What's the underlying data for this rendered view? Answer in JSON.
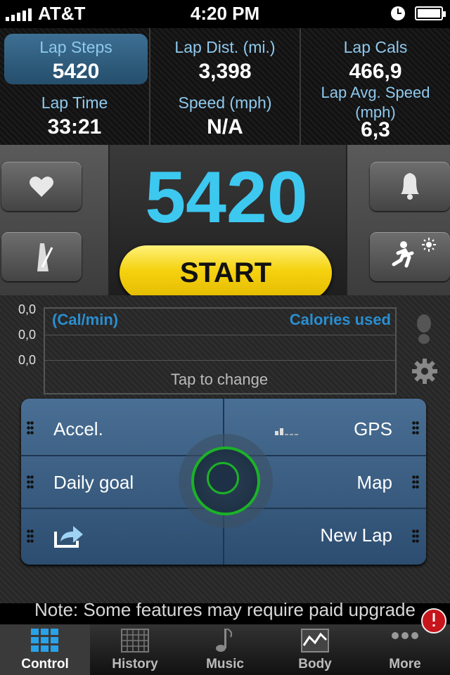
{
  "status_bar": {
    "carrier": "AT&T",
    "time": "4:20 PM"
  },
  "stats": [
    {
      "label": "Lap Steps",
      "value": "5420"
    },
    {
      "label": "Lap Dist. (mi.)",
      "value": "3,398"
    },
    {
      "label": "Lap Cals",
      "value": "466,9"
    },
    {
      "label": "Lap Time",
      "value": "33:21"
    },
    {
      "label": "Speed (mph)",
      "value": "N/A"
    },
    {
      "label": "Lap Avg. Speed (mph)",
      "value": "6,3"
    }
  ],
  "counter": {
    "value": "5420"
  },
  "start_label": "START",
  "graph": {
    "y_labels": [
      "0,0",
      "0,0",
      "0,0"
    ],
    "left_label": "(Cal/min)",
    "right_label": "Calories used",
    "tap_label": "Tap to change"
  },
  "controls": {
    "accel": "Accel.",
    "gps": "GPS",
    "daily_goal": "Daily goal",
    "map": "Map",
    "new_lap": "New Lap"
  },
  "note": "Note: Some features may require paid upgrade",
  "tabs": [
    "Control",
    "History",
    "Music",
    "Body",
    "More"
  ],
  "colors": {
    "accent": "#3dc8f0",
    "label_blue": "#8fc9ee",
    "start_yellow": "#f5d210",
    "ring_green": "#1bb227"
  },
  "icons": [
    "heart-icon",
    "metronome-icon",
    "bell-icon",
    "runner-sun-icon",
    "footprint-icon",
    "gear-icon",
    "share-icon",
    "gps-signal-icon"
  ]
}
